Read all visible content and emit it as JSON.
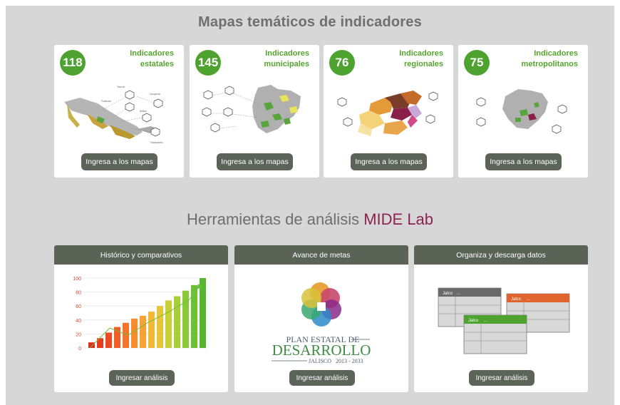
{
  "header": {
    "title": "Mapas temáticos de indicadores"
  },
  "map_cards": [
    {
      "count": "118",
      "label_1": "Indicadores",
      "label_2": "estatales",
      "button": "Ingresa a los mapas"
    },
    {
      "count": "145",
      "label_1": "Indicadores",
      "label_2": "municipales",
      "button": "Ingresa a los mapas"
    },
    {
      "count": "76",
      "label_1": "Indicadores",
      "label_2": "regionales",
      "button": "Ingresa a los mapas"
    },
    {
      "count": "75",
      "label_1": "Indicadores",
      "label_2": "metropolitanos",
      "button": "Ingresa a los mapas"
    }
  ],
  "tools": {
    "title_prefix": "Herramientas de análisis",
    "title_accent": "MIDE Lab",
    "cards": [
      {
        "header": "Histórico y comparativos",
        "button": "Ingresar análisis"
      },
      {
        "header": "Avance de metas",
        "button": "Ingresar análisis"
      },
      {
        "header": "Organiza y descarga datos",
        "button": "Ingresar análisis"
      }
    ]
  },
  "chart_illustration": {
    "y_ticks": [
      "100",
      "80",
      "60",
      "40",
      "20",
      "0"
    ],
    "bar_levels": [
      0.08,
      0.14,
      0.22,
      0.3,
      0.36,
      0.42,
      0.46,
      0.52,
      0.6,
      0.68,
      0.74,
      0.82,
      0.9,
      1.0
    ]
  },
  "plan_logo": {
    "line1": "PLAN ESTATAL DE",
    "line2": "DESARROLLO",
    "line3": "JALISCO",
    "line4": "2013 - 2033"
  },
  "table_illustration": {
    "gray_header": "Jalco",
    "orange_header": "Jalco",
    "green_header": "Jalco",
    "ellipsis": "..."
  },
  "colors": {
    "accent_green": "#4ea22f",
    "button_bg": "#5c6358",
    "mide_accent": "#8c2350"
  }
}
